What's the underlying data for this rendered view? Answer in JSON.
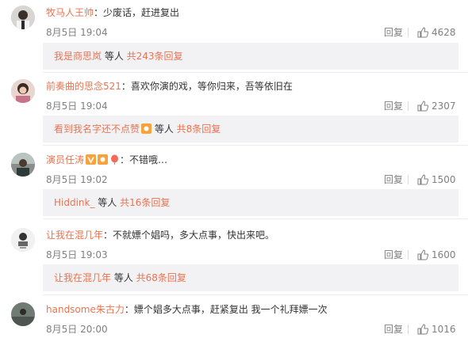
{
  "colors": {
    "username": "#eb7350",
    "text": "#333333",
    "meta": "#808080",
    "reply_box_bg": "#f2f2f5"
  },
  "comments": [
    {
      "username": "牧马人王帅",
      "text": "：少废话，赶进复出",
      "time": "8月5日 19:04",
      "reply_label": "回复",
      "likes": "4628",
      "sub_reply": {
        "user": "我是商思岚",
        "middle": " 等人 ",
        "count": "共243条回复"
      }
    },
    {
      "username": "前奏曲的思念521",
      "text": "：喜欢你演的戏，等你归来，吾等依旧在",
      "time": "8月5日 19:04",
      "reply_label": "回复",
      "likes": "2307",
      "sub_reply": {
        "user": "看到我名字还不点赞",
        "middle": " 等人 ",
        "count": "共8条回复"
      }
    },
    {
      "username": "演员任涛",
      "text": "：不错哦…",
      "time": "8月5日 19:02",
      "reply_label": "回复",
      "likes": "1500",
      "sub_reply": {
        "user": "Hiddink_",
        "middle": " 等人 ",
        "count": "共16条回复"
      }
    },
    {
      "username": "让我在混几年",
      "text": "：不就嫖个娼吗，多大点事，快出来吧。",
      "time": "8月5日 19:03",
      "reply_label": "回复",
      "likes": "1600",
      "sub_reply": {
        "user": "让我在混几年",
        "middle": " 等人 ",
        "count": "共68条回复"
      }
    },
    {
      "username": "handsome朱古力",
      "text": "：嫖个娼多大点事，赶紧复出   我一个礼拜嫖一次",
      "time": "8月5日 20:00",
      "reply_label": "回复",
      "likes": "1016"
    }
  ]
}
